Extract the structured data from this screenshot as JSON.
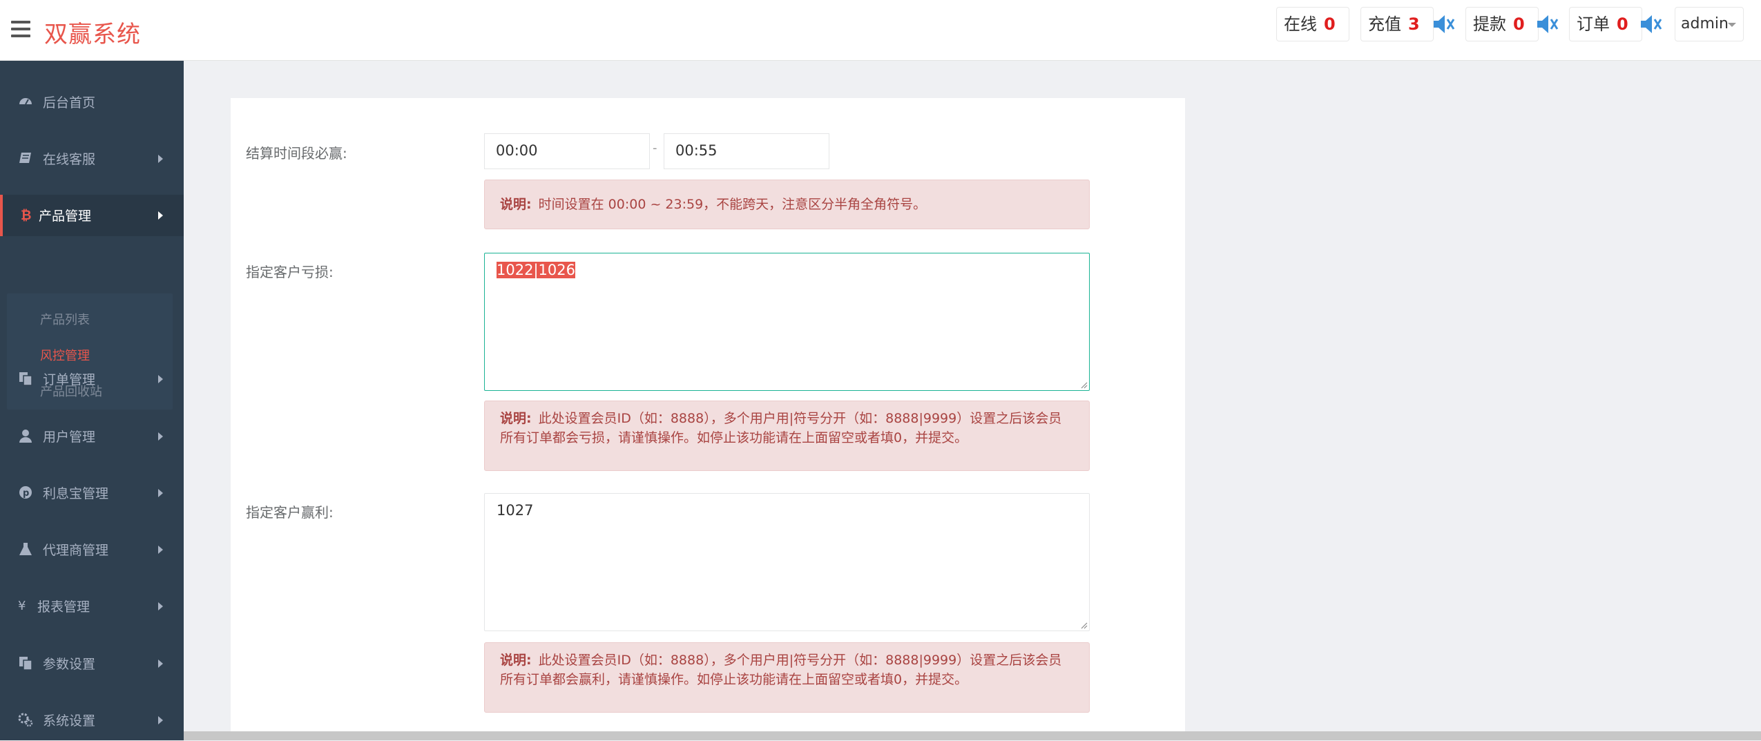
{
  "app": {
    "brand": "双赢系统"
  },
  "header": {
    "stats": [
      {
        "label": "在线",
        "value": "0"
      },
      {
        "label": "充值",
        "value": "3"
      },
      {
        "label": "提款",
        "value": "0"
      },
      {
        "label": "订单",
        "value": "0"
      }
    ],
    "user": "admin"
  },
  "sidebar": {
    "items": [
      {
        "label": "后台首页",
        "icon": "dashboard-icon"
      },
      {
        "label": "在线客服",
        "icon": "book-icon"
      },
      {
        "label": "产品管理",
        "icon": "bitcoin-icon"
      },
      {
        "label": "订单管理",
        "icon": "copy-icon"
      },
      {
        "label": "用户管理",
        "icon": "user-icon"
      },
      {
        "label": "利息宝管理",
        "icon": "pinterest-icon"
      },
      {
        "label": "代理商管理",
        "icon": "flask-icon"
      },
      {
        "label": "报表管理",
        "icon": "yen-icon"
      },
      {
        "label": "参数设置",
        "icon": "copy-icon"
      },
      {
        "label": "系统设置",
        "icon": "gears-icon"
      }
    ],
    "sub_items": [
      "产品列表",
      "风控管理",
      "产品回收站"
    ]
  },
  "form": {
    "time_label": "结算时间段必赢:",
    "time_start": "00:00",
    "time_separator": "-",
    "time_end": "00:55",
    "time_note_title": "说明:",
    "time_note": "时间设置在 00:00 ~ 23:59，不能跨天，注意区分半角全角符号。",
    "loss_label": "指定客户亏损:",
    "loss_value": "1022|1026",
    "loss_note_title": "说明:",
    "loss_note": "此处设置会员ID（如：8888），多个用户用|符号分开（如：8888|9999）设置之后该会员所有订单都会亏损，请谨慎操作。如停止该功能请在上面留空或者填0，并提交。",
    "win_label": "指定客户赢利:",
    "win_value": "1027",
    "win_note_title": "说明:",
    "win_note": "此处设置会员ID（如：8888），多个用户用|符号分开（如：8888|9999）设置之后该会员所有订单都会赢利，请谨慎操作。如停止该功能请在上面留空或者填0，并提交。"
  },
  "colors": {
    "brand": "#e8564c",
    "sidebar_bg": "#2f4050",
    "note_bg": "#f2dede",
    "note_text": "#a94442",
    "stat_value": "#e01e1e"
  }
}
